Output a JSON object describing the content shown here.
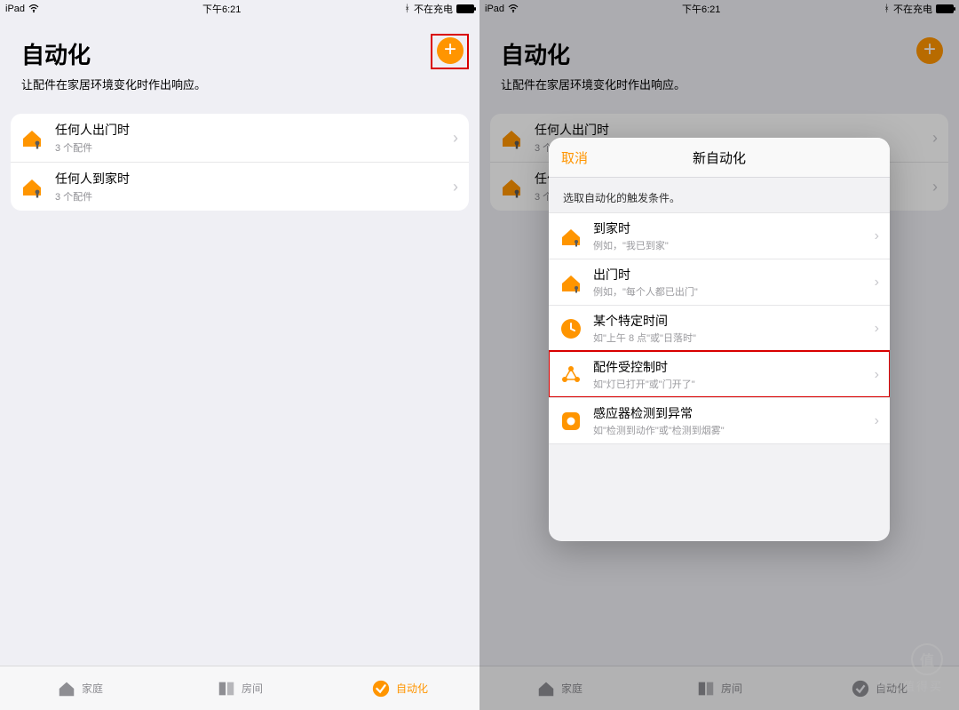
{
  "status": {
    "device": "iPad",
    "time": "下午6:21",
    "bt": "不在充电"
  },
  "header": {
    "title": "自动化",
    "subtitle": "让配件在家居环境变化时作出响应。"
  },
  "automations": [
    {
      "title": "任何人出门时",
      "sub": "3 个配件"
    },
    {
      "title": "任何人到家时",
      "sub": "3 个配件"
    }
  ],
  "tabs": {
    "home": "家庭",
    "rooms": "房间",
    "automation": "自动化"
  },
  "sheet": {
    "cancel": "取消",
    "title": "新自动化",
    "prompt": "选取自动化的触发条件。",
    "items": [
      {
        "t": "到家时",
        "s": "例如，\"我已到家\""
      },
      {
        "t": "出门时",
        "s": "例如，\"每个人都已出门\""
      },
      {
        "t": "某个特定时间",
        "s": "如\"上午 8 点\"或\"日落时\""
      },
      {
        "t": "配件受控制时",
        "s": "如\"灯已打开\"或\"门开了\""
      },
      {
        "t": "感应器检测到异常",
        "s": "如\"检测到动作\"或\"检测到烟雾\""
      }
    ]
  },
  "watermark": "什么值得买"
}
